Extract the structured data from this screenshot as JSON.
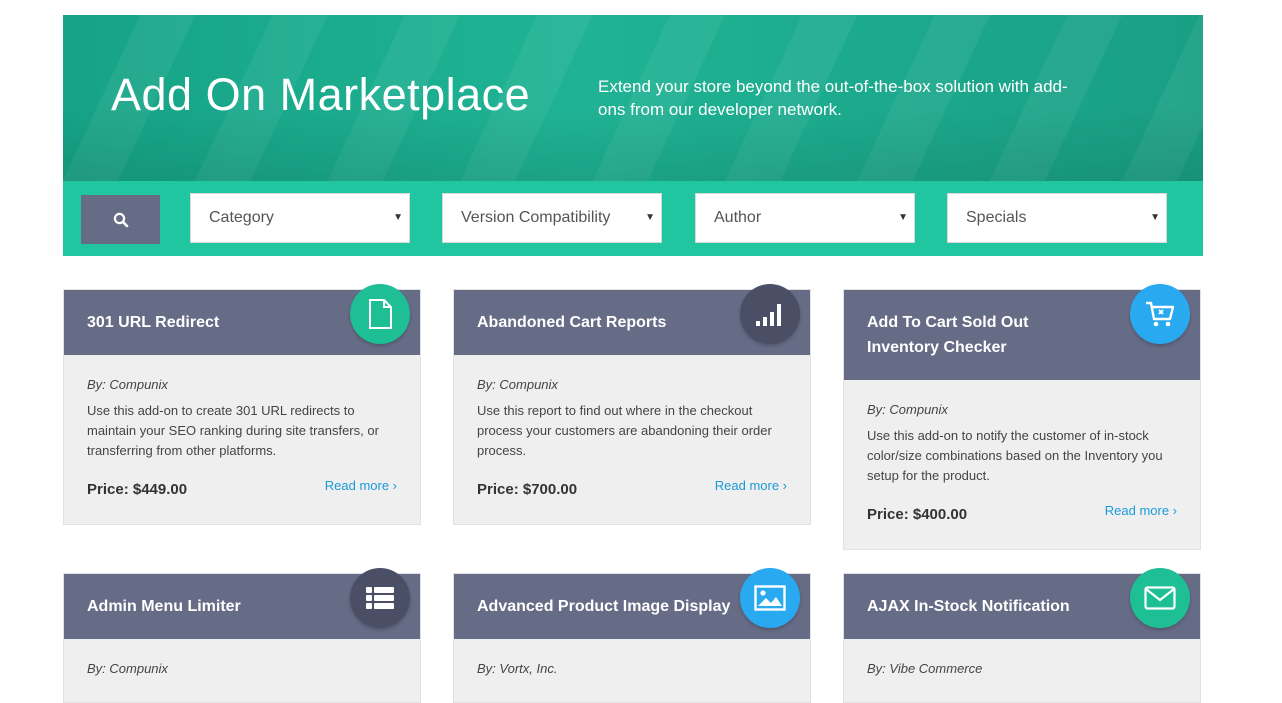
{
  "hero": {
    "title": "Add On Marketplace",
    "subtitle": "Extend your store beyond the out-of-the-box solution with add-ons from our developer network."
  },
  "filters": {
    "search_icon": "search-icon",
    "category": "Category",
    "version": "Version Compatibility",
    "author": "Author",
    "specials": "Specials"
  },
  "colors": {
    "hero_bg": "#1aa98a",
    "filterbar_bg": "#1fc6a0",
    "card_header": "#666b86",
    "link": "#1b9bd8",
    "badge_green": "#1fbf95",
    "badge_dark": "#4b4f66",
    "badge_blue": "#29a9f0"
  },
  "cards": [
    {
      "title": "301 URL Redirect",
      "icon": "document-icon",
      "author": "By: Compunix",
      "description": "Use this add-on to create 301 URL redirects to maintain your SEO ranking during site transfers, or transferring from other platforms.",
      "price": "Price: $449.00",
      "more": "Read more ›"
    },
    {
      "title": "Abandoned Cart Reports",
      "icon": "signal-bars-icon",
      "author": "By: Compunix",
      "description": "Use this report to find out where in the checkout process your customers are abandoning their order process.",
      "price": "Price: $700.00",
      "more": "Read more ›"
    },
    {
      "title": "Add To Cart Sold Out Inventory Checker",
      "icon": "cart-icon",
      "author": "By: Compunix",
      "description": "Use this add-on to notify the customer of in-stock color/size combinations based on the Inventory you setup for the product.",
      "price": "Price: $400.00",
      "more": "Read more ›"
    },
    {
      "title": "Admin Menu Limiter",
      "icon": "list-icon",
      "author": "By: Compunix"
    },
    {
      "title": "Advanced Product Image Display",
      "icon": "image-icon",
      "author": "By: Vortx, Inc."
    },
    {
      "title": "AJAX In-Stock Notification",
      "icon": "envelope-icon",
      "author": "By: Vibe Commerce"
    }
  ]
}
